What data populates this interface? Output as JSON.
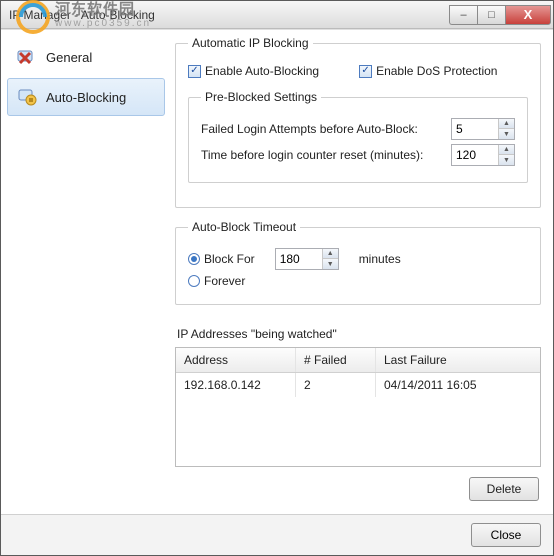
{
  "window": {
    "title": "IP Manager - Auto-Blocking"
  },
  "watermark": {
    "text": "河东软件园",
    "url": "www.pc0359.cn"
  },
  "winbuttons": {
    "min": "–",
    "max": "□",
    "close": "X"
  },
  "sidebar": {
    "items": [
      {
        "label": "General"
      },
      {
        "label": "Auto-Blocking"
      }
    ]
  },
  "groups": {
    "auto": {
      "legend": "Automatic IP Blocking",
      "enable_auto": "Enable Auto-Blocking",
      "enable_dos": "Enable DoS Protection",
      "pre_legend": "Pre-Blocked Settings",
      "failed_label": "Failed Login Attempts before Auto-Block:",
      "failed_value": "5",
      "reset_label": "Time before login counter reset (minutes):",
      "reset_value": "120"
    },
    "timeout": {
      "legend": "Auto-Block Timeout",
      "block_for": "Block For",
      "block_value": "180",
      "minutes": "minutes",
      "forever": "Forever"
    }
  },
  "watched": {
    "label": "IP Addresses \"being watched\"",
    "headers": {
      "address": "Address",
      "failed": "# Failed",
      "last": "Last Failure"
    },
    "rows": [
      {
        "address": "192.168.0.142",
        "failed": "2",
        "last": "04/14/2011  16:05"
      }
    ]
  },
  "buttons": {
    "delete": "Delete",
    "close": "Close"
  }
}
